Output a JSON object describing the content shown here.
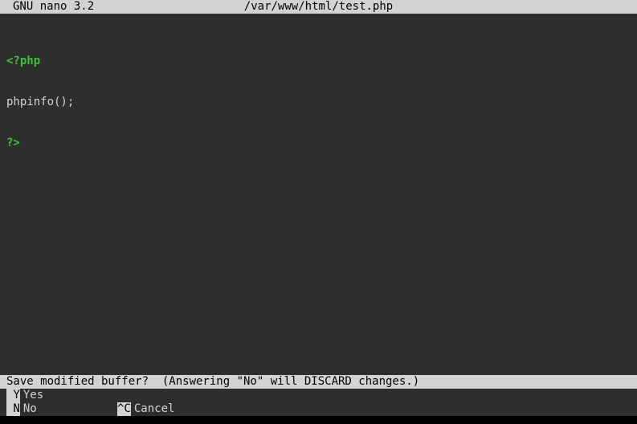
{
  "titlebar": {
    "app": "GNU nano 3.2",
    "filename": "/var/www/html/test.php"
  },
  "code": {
    "line1": "<?php",
    "line2": "phpinfo();",
    "line3": "?>"
  },
  "prompt": {
    "text": "Save modified buffer?  (Answering \"No\" will DISCARD changes.) "
  },
  "help": {
    "yes_key": " Y",
    "yes_label": "Yes",
    "no_key": " N",
    "no_label": "No",
    "cancel_key": "^C",
    "cancel_label": "Cancel"
  }
}
